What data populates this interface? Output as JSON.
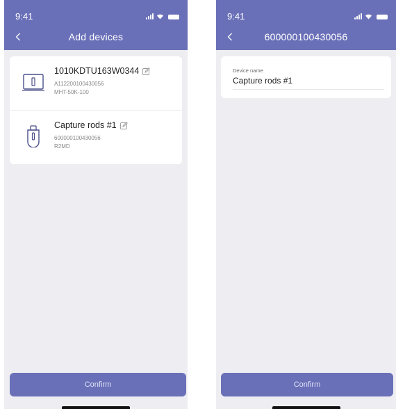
{
  "left_screen": {
    "status_time": "9:41",
    "title": "Add devices",
    "devices": [
      {
        "name": "1010KDTU163W0344",
        "serial": "A112200100430056",
        "model": "MHT-50K-100",
        "icon": "inverter-icon"
      },
      {
        "name": "Capture rods #1",
        "serial": "600000100430056",
        "model": "R2MD",
        "icon": "usb-stick-icon"
      }
    ],
    "confirm_label": "Confirm"
  },
  "right_screen": {
    "status_time": "9:41",
    "title": "600000100430056",
    "field_label": "Device name",
    "field_value": "Capture rods #1",
    "confirm_label": "Confirm"
  },
  "colors": {
    "primary": "#6a70b8",
    "background": "#eeeef2",
    "card": "#ffffff"
  }
}
